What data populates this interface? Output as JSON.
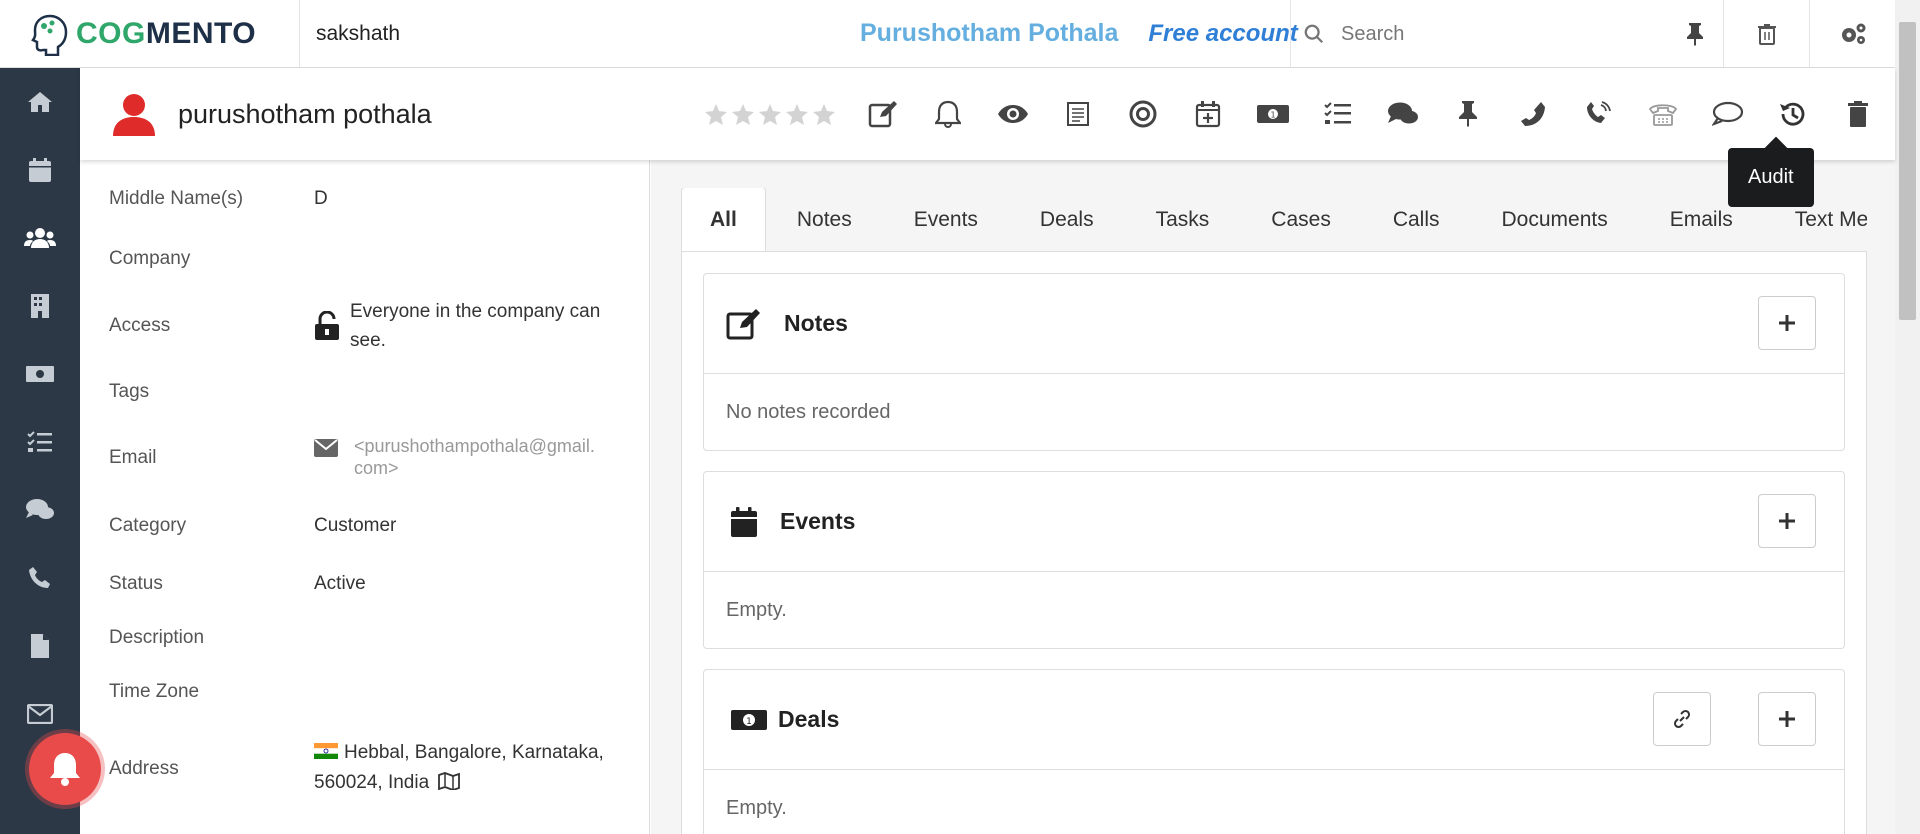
{
  "brand": {
    "cog": "COG",
    "mento": "MENTO"
  },
  "topbar": {
    "username": "sakshath",
    "account_name": "Purushotham Pothala",
    "account_type": "Free account",
    "search_placeholder": "Search",
    "icons": [
      "pin-icon",
      "trash-icon",
      "settings-icon"
    ]
  },
  "sidebar": {
    "items": [
      "home-icon",
      "calendar-icon",
      "contacts-icon",
      "companies-icon",
      "deals-icon",
      "tasks-icon",
      "chat-icon",
      "phone-icon",
      "documents-icon",
      "email-icon"
    ],
    "active_index": 2
  },
  "contact": {
    "name": "purushotham pothala",
    "rating": 0,
    "rating_max": 5
  },
  "actions": [
    "edit",
    "reminder",
    "watch",
    "form",
    "target",
    "add-event",
    "deal",
    "tasks",
    "chat",
    "pin",
    "call",
    "voip",
    "hangup",
    "sms",
    "audit",
    "delete"
  ],
  "tooltip": {
    "text": "Audit"
  },
  "details": {
    "middle_name_label": "Middle Name(s)",
    "middle_name": "D",
    "company_label": "Company",
    "access_label": "Access",
    "access_line1": "Everyone in the company can",
    "access_line2": "see.",
    "tags_label": "Tags",
    "email_label": "Email",
    "email_line1": "<purushothampothala@gmail.",
    "email_line2": "com>",
    "category_label": "Category",
    "category": "Customer",
    "status_label": "Status",
    "status": "Active",
    "description_label": "Description",
    "timezone_label": "Time Zone",
    "address_label": "Address",
    "address_line1": "Hebbal, Bangalore, Karnataka,",
    "address_line2": "560024, India"
  },
  "tabs": [
    "All",
    "Notes",
    "Events",
    "Deals",
    "Tasks",
    "Cases",
    "Calls",
    "Documents",
    "Emails",
    "Text Messages"
  ],
  "cards": {
    "notes": {
      "title": "Notes",
      "empty": "No notes recorded"
    },
    "events": {
      "title": "Events",
      "empty": "Empty."
    },
    "deals": {
      "title": "Deals",
      "empty": "Empty."
    }
  },
  "colors": {
    "sidebar": "#2c3846",
    "accent_green": "#2fa66a",
    "account_blue": "#64aee0",
    "avatar_red": "#e02b2b"
  }
}
